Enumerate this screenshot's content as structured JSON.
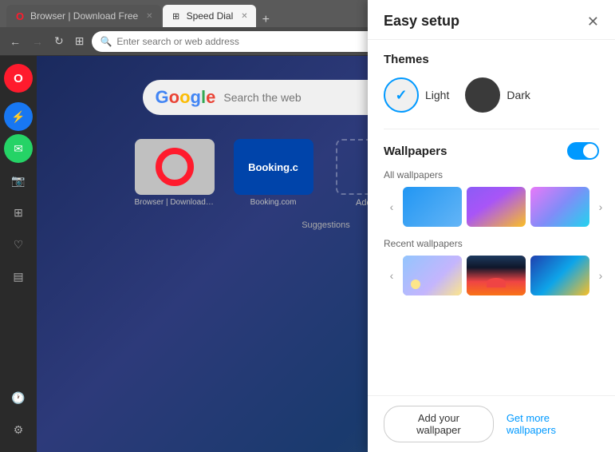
{
  "browser": {
    "tabs": [
      {
        "label": "Browser | Download Free",
        "active": false,
        "favicon": "O"
      },
      {
        "label": "Speed Dial",
        "active": true,
        "favicon": "⊞"
      }
    ],
    "add_tab_label": "+",
    "address_placeholder": "Enter search or web address",
    "address_value": "",
    "nav": {
      "back": "←",
      "forward": "→",
      "reload": "↻",
      "tabs": "⊞"
    },
    "window_controls": {
      "minimize": "–",
      "maximize": "□",
      "close": "✕",
      "menu": "≡"
    }
  },
  "sidebar": {
    "items": [
      {
        "icon": "○",
        "name": "opera-icon",
        "label": "Opera"
      },
      {
        "icon": "⚡",
        "name": "messenger-icon",
        "label": "Messenger"
      },
      {
        "icon": "✉",
        "name": "whatsapp-icon",
        "label": "WhatsApp"
      },
      {
        "icon": "📷",
        "name": "instagram-icon",
        "label": "Instagram"
      },
      {
        "icon": "⊞",
        "name": "apps-icon",
        "label": "Apps"
      },
      {
        "icon": "♡",
        "name": "favorites-icon",
        "label": "Favorites"
      },
      {
        "icon": "▤",
        "name": "feed-icon",
        "label": "Feed"
      },
      {
        "icon": "🕐",
        "name": "history-icon",
        "label": "History"
      },
      {
        "icon": "⚙",
        "name": "settings-icon",
        "label": "Settings"
      }
    ]
  },
  "speed_dial": {
    "google": {
      "logo_b": "G",
      "search_placeholder": "Search the web"
    },
    "items": [
      {
        "label": "Browser | Download Free | Fast...",
        "type": "opera"
      },
      {
        "label": "Booking.com",
        "type": "booking"
      }
    ],
    "add_site_label": "Add a site",
    "suggestions_label": "Suggestions"
  },
  "easy_setup": {
    "title": "Easy setup",
    "close_icon": "✕",
    "themes": {
      "section_title": "Themes",
      "options": [
        {
          "label": "Light",
          "selected": true
        },
        {
          "label": "Dark",
          "selected": false
        }
      ]
    },
    "wallpapers": {
      "section_title": "Wallpapers",
      "toggle_on": true,
      "all_label": "All wallpapers",
      "recent_label": "Recent wallpapers",
      "all_items": [
        {
          "type": "wp-blue",
          "label": "Blue"
        },
        {
          "type": "wp-purple",
          "label": "Purple"
        },
        {
          "type": "wp-pink",
          "label": "Pink"
        }
      ],
      "recent_items": [
        {
          "type": "wp-room",
          "label": "Room"
        },
        {
          "type": "wp-sunset",
          "label": "Sunset"
        },
        {
          "type": "wp-blue2",
          "label": "Blue2"
        }
      ],
      "nav_prev": "‹",
      "nav_next": "›"
    },
    "footer": {
      "add_button_label": "Add your wallpaper",
      "get_more_label": "Get more wallpapers"
    }
  }
}
